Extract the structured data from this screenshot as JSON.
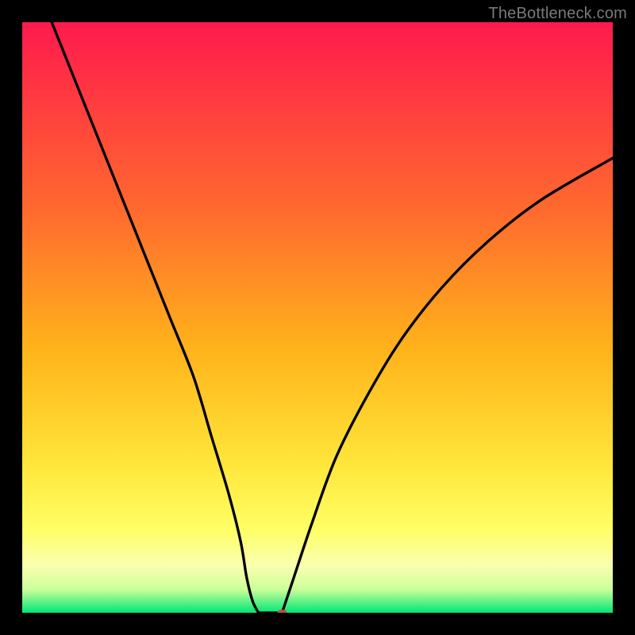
{
  "watermark": "TheBottleneck.com",
  "chart_data": {
    "type": "line",
    "title": "",
    "xlabel": "",
    "ylabel": "",
    "xlim": [
      0,
      100
    ],
    "ylim": [
      0,
      100
    ],
    "grid": false,
    "axes_visible": false,
    "background_gradient": {
      "top": "#FF1A4D",
      "mid": "#FFB21A",
      "lower": "#FFFF66",
      "band": "#F9FFB0",
      "bottom": "#00E676"
    },
    "series": [
      {
        "name": "left-branch",
        "values": [
          {
            "x": 5,
            "y": 100
          },
          {
            "x": 9,
            "y": 90
          },
          {
            "x": 13,
            "y": 80
          },
          {
            "x": 17,
            "y": 70
          },
          {
            "x": 21,
            "y": 60
          },
          {
            "x": 25,
            "y": 50
          },
          {
            "x": 29,
            "y": 40
          },
          {
            "x": 32,
            "y": 30
          },
          {
            "x": 35,
            "y": 20
          },
          {
            "x": 37,
            "y": 12
          },
          {
            "x": 38,
            "y": 6
          },
          {
            "x": 39,
            "y": 2
          },
          {
            "x": 40,
            "y": 0
          }
        ]
      },
      {
        "name": "flat-min",
        "values": [
          {
            "x": 40,
            "y": 0
          },
          {
            "x": 44,
            "y": 0
          }
        ]
      },
      {
        "name": "right-branch",
        "values": [
          {
            "x": 44,
            "y": 0
          },
          {
            "x": 46,
            "y": 6
          },
          {
            "x": 49,
            "y": 15
          },
          {
            "x": 53,
            "y": 26
          },
          {
            "x": 58,
            "y": 36
          },
          {
            "x": 64,
            "y": 46
          },
          {
            "x": 71,
            "y": 55
          },
          {
            "x": 79,
            "y": 63
          },
          {
            "x": 88,
            "y": 70
          },
          {
            "x": 100,
            "y": 77
          }
        ]
      }
    ],
    "marker": {
      "x": 44,
      "y": 0,
      "color": "#C44B3E",
      "rx": 6,
      "ry": 4
    }
  }
}
